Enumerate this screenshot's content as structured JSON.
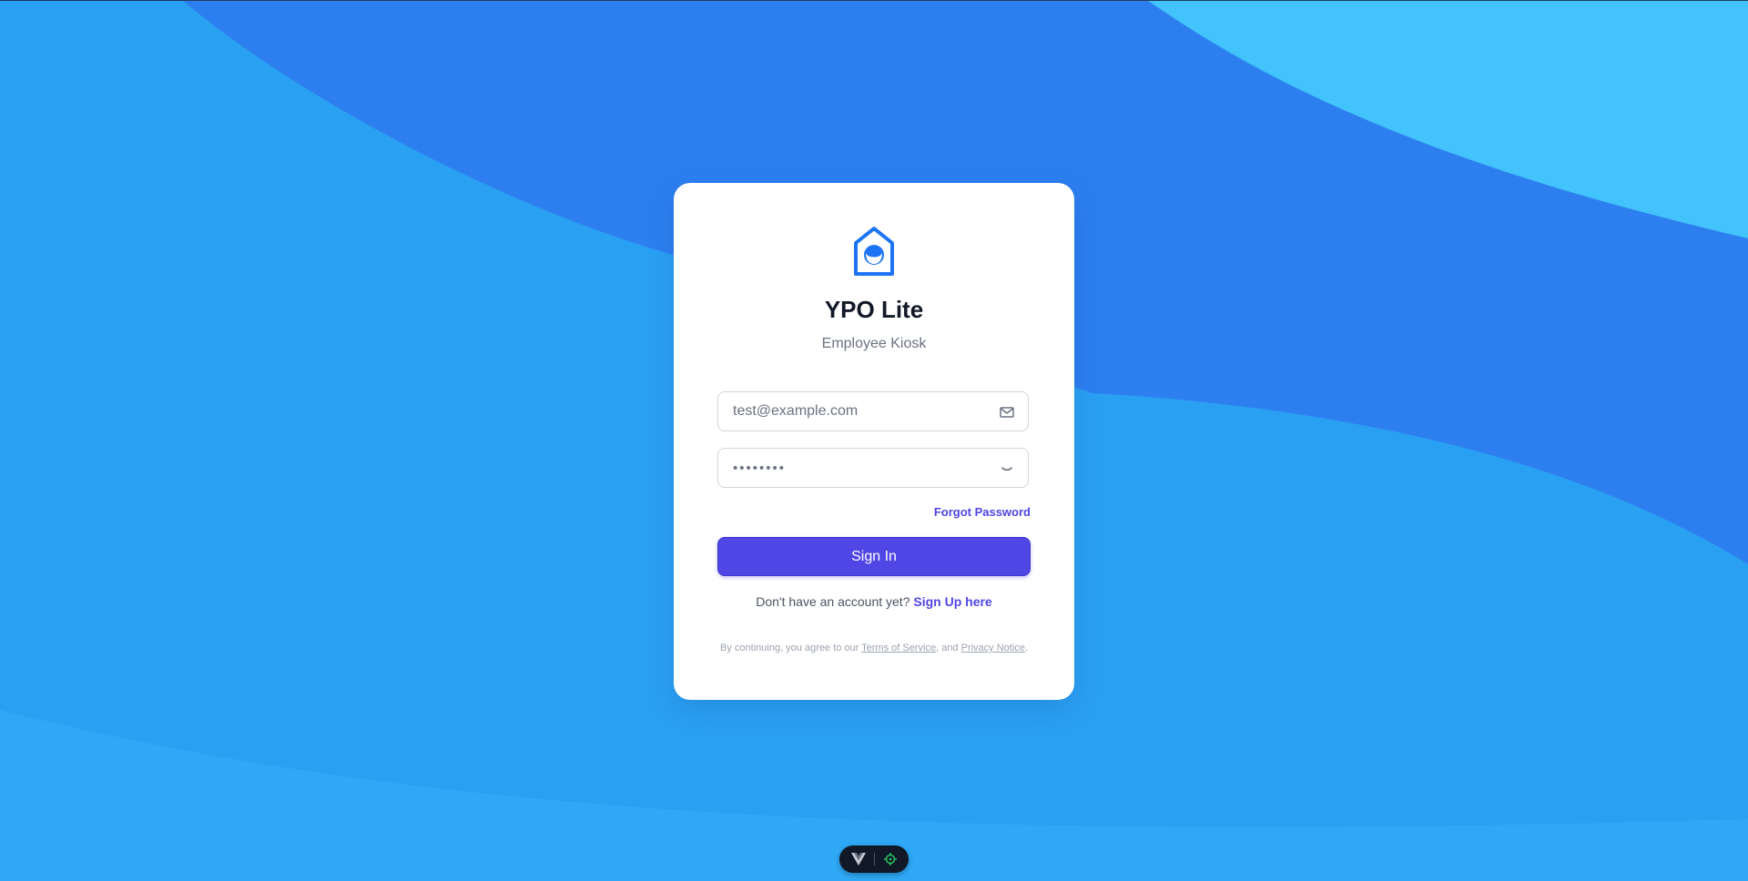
{
  "app": {
    "title": "YPO Lite",
    "subtitle": "Employee Kiosk",
    "logo_icon": "house-face-icon"
  },
  "form": {
    "email_value": "test@example.com",
    "email_icon": "mail-icon",
    "password_value": "••••••••",
    "password_icon": "eye-closed-icon",
    "forgot_label": "Forgot Password",
    "signin_label": "Sign In"
  },
  "signup": {
    "prompt": "Don't have an account yet?",
    "link_label": "Sign Up here"
  },
  "legal": {
    "prefix": "By continuing, you agree to our",
    "terms_label": "Terms of Service",
    "middle": ", and",
    "privacy_label": "Privacy Notice",
    "suffix": "."
  },
  "devtools": {
    "vue_icon": "vue-logo-icon",
    "inspect_icon": "inspector-target-icon"
  },
  "colors": {
    "accent": "#4f46e5",
    "background": "#2a9ff2",
    "logo": "#1d74f5"
  }
}
